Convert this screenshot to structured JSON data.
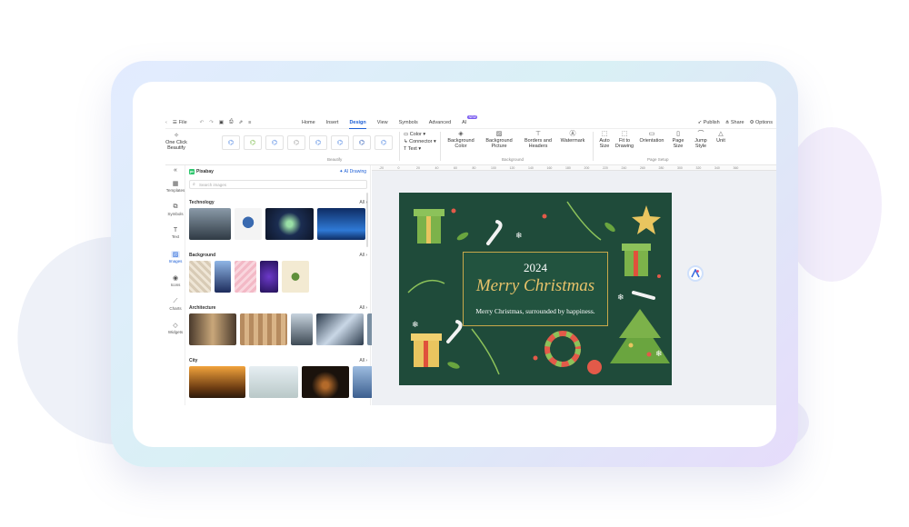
{
  "menubar": {
    "file_label": "File",
    "tabs": [
      {
        "label": "Home"
      },
      {
        "label": "Insert"
      },
      {
        "label": "Design"
      },
      {
        "label": "View"
      },
      {
        "label": "Symbols"
      },
      {
        "label": "Advanced"
      },
      {
        "label": "AI"
      }
    ],
    "ai_badge": "NEW",
    "active_tab": "Design",
    "publish_label": "Publish",
    "share_label": "Share",
    "options_label": "Options"
  },
  "ribbon": {
    "one_click_beautify": "One Click Beautify",
    "beautify_group": "Beautify",
    "color_label": "Color",
    "connector_label": "Connector",
    "text_label": "Text",
    "background_color": "Background Color",
    "background_picture": "Background Picture",
    "borders_headers": "Borders and Headers",
    "watermark": "Watermark",
    "background_group": "Background",
    "auto_size": "Auto Size",
    "fit_to_drawing": "Fit to Drawing",
    "orientation": "Orientation",
    "page_size": "Page Size",
    "jump_style": "Jump Style",
    "unit": "Unit",
    "page_setup_group": "Page Setup"
  },
  "rail": {
    "items": [
      {
        "label": "Templates",
        "icon": "templates-icon"
      },
      {
        "label": "Symbols",
        "icon": "symbols-icon"
      },
      {
        "label": "Text",
        "icon": "text-icon"
      },
      {
        "label": "Images",
        "icon": "images-icon"
      },
      {
        "label": "Icons",
        "icon": "icons-icon"
      },
      {
        "label": "Charts",
        "icon": "charts-icon"
      },
      {
        "label": "Widgets",
        "icon": "widgets-icon"
      }
    ]
  },
  "panel": {
    "source": "Pixabay",
    "ai_drawing": "AI Drawing",
    "search_placeholder": "Search images",
    "all_label": "All",
    "categories": [
      {
        "name": "Technology"
      },
      {
        "name": "Background"
      },
      {
        "name": "Architecture"
      },
      {
        "name": "City"
      }
    ]
  },
  "ruler": [
    "-20",
    "0",
    "20",
    "40",
    "60",
    "80",
    "100",
    "120",
    "140",
    "160",
    "180",
    "200",
    "220",
    "240",
    "260",
    "280",
    "300",
    "320",
    "340",
    "360"
  ],
  "card": {
    "year": "2024",
    "title": "Merry Christmas",
    "subtitle": "Merry Christmas, surrounded by happiness."
  },
  "colors": {
    "accent": "#1d5fd6",
    "card_bg": "#1f4b3a",
    "card_gold": "#e7c26a"
  }
}
